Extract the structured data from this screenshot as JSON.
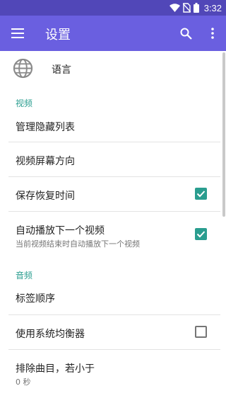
{
  "status_bar": {
    "time": "3:32",
    "icons": [
      "wifi-icon",
      "no-sim-icon",
      "battery-icon"
    ]
  },
  "app_bar": {
    "title": "设置",
    "menu_icon": "hamburger-menu-icon",
    "search_icon": "search-icon",
    "more_icon": "more-vert-icon"
  },
  "language": {
    "label": "语言",
    "icon": "globe-icon"
  },
  "sections": {
    "video": {
      "header": "视频",
      "items": [
        {
          "title": "管理隐藏列表"
        },
        {
          "title": "视频屏幕方向"
        },
        {
          "title": "保存恢复时间",
          "checked": true
        },
        {
          "title": "自动播放下一个视频",
          "subtitle": "当前视频结束时自动播放下一个视频",
          "checked": true
        }
      ]
    },
    "audio": {
      "header": "音频",
      "items": [
        {
          "title": "标签顺序"
        },
        {
          "title": "使用系统均衡器",
          "checked": false
        },
        {
          "title": "排除曲目，若小于",
          "subtitle": "0 秒"
        }
      ]
    }
  },
  "colors": {
    "status_bar": "#5147b8",
    "app_bar": "#6a5fe0",
    "accent": "#2a9d8f"
  }
}
